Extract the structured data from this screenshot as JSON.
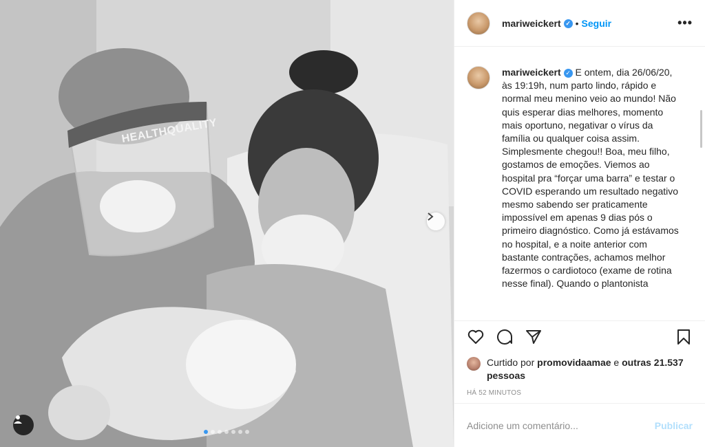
{
  "post": {
    "image_alt": "Foto em preto e branco de mãe com recém-nascido e médico com protetor facial",
    "logo_text": "HEALTHQUALITY",
    "carousel_count": 7,
    "carousel_active_index": 0,
    "icons": {
      "next": "chevron-right-icon",
      "tag": "user-tag-icon"
    }
  },
  "header": {
    "username": "mariweickert",
    "separator": "•",
    "follow_label": "Seguir",
    "more_label": "•••"
  },
  "caption": {
    "username": "mariweickert",
    "text": "E ontem, dia 26/06/20, às 19:19h, num parto lindo, rápido e normal meu menino veio ao mundo! Não quis esperar dias melhores, momento mais oportuno, negativar o vírus da família ou qualquer coisa assim. Simplesmente chegou!! Boa, meu filho, gostamos de emoções. Viemos ao hospital pra “forçar uma barra” e testar o COVID esperando um resultado negativo mesmo sabendo ser praticamente impossível em apenas 9 dias pós o primeiro diagnóstico. Como já estávamos no hospital, e a noite anterior com bastante contrações, achamos melhor fazermos o cardiotoco (exame de rotina nesse final). Quando o plantonista"
  },
  "likes": {
    "prefix": "Curtido por ",
    "user": "promovidaamae",
    "middle": " e ",
    "others": "outras 21.537 pessoas"
  },
  "time": "HÁ 52 MINUTOS",
  "comment": {
    "placeholder": "Adicione um comentário...",
    "publish_label": "Publicar"
  },
  "colors": {
    "accent": "#0095f6",
    "verified": "#3897f0",
    "publish_disabled": "#b2dffc",
    "muted": "#8e8e8e"
  }
}
